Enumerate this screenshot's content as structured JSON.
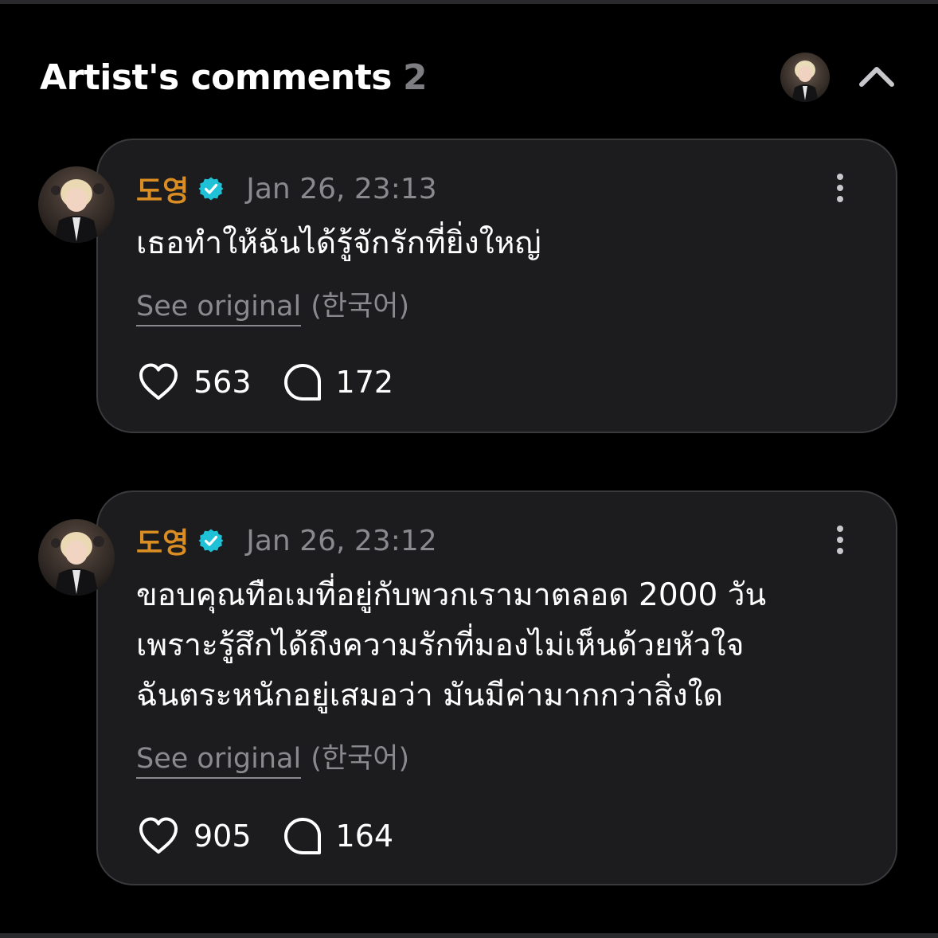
{
  "header": {
    "title": "Artist's comments",
    "count": "2"
  },
  "comments": [
    {
      "author": "도영",
      "timestamp": "Jan 26, 23:13",
      "text": "เธอทำให้ฉันได้รู้จักรักที่ยิ่งใหญ่",
      "see_original": "See original",
      "language": "(한국어)",
      "likes": "563",
      "replies": "172"
    },
    {
      "author": "도영",
      "timestamp": "Jan 26, 23:12",
      "text": "ขอบคุณทือเมที่อยู่กับพวกเรามาตลอด 2000 วัน\nเพราะรู้สึกได้ถึงความรักที่มองไม่เห็นด้วยหัวใจ\nฉันตระหนักอยู่เสมอว่า มันมีค่ามากกว่าสิ่งใด",
      "see_original": "See original",
      "language": "(한국어)",
      "likes": "905",
      "replies": "164"
    }
  ],
  "icons": {
    "verified": "verified-check-icon",
    "like": "heart-icon",
    "reply": "speech-bubble-icon",
    "more": "more-vertical-icon",
    "collapse": "chevron-up-icon"
  },
  "colors": {
    "background": "#000000",
    "card": "#1c1c1e",
    "card_border": "#3a3a3c",
    "author": "#d98d22",
    "verified": "#1fc1d6",
    "muted": "#8a8a8e"
  }
}
